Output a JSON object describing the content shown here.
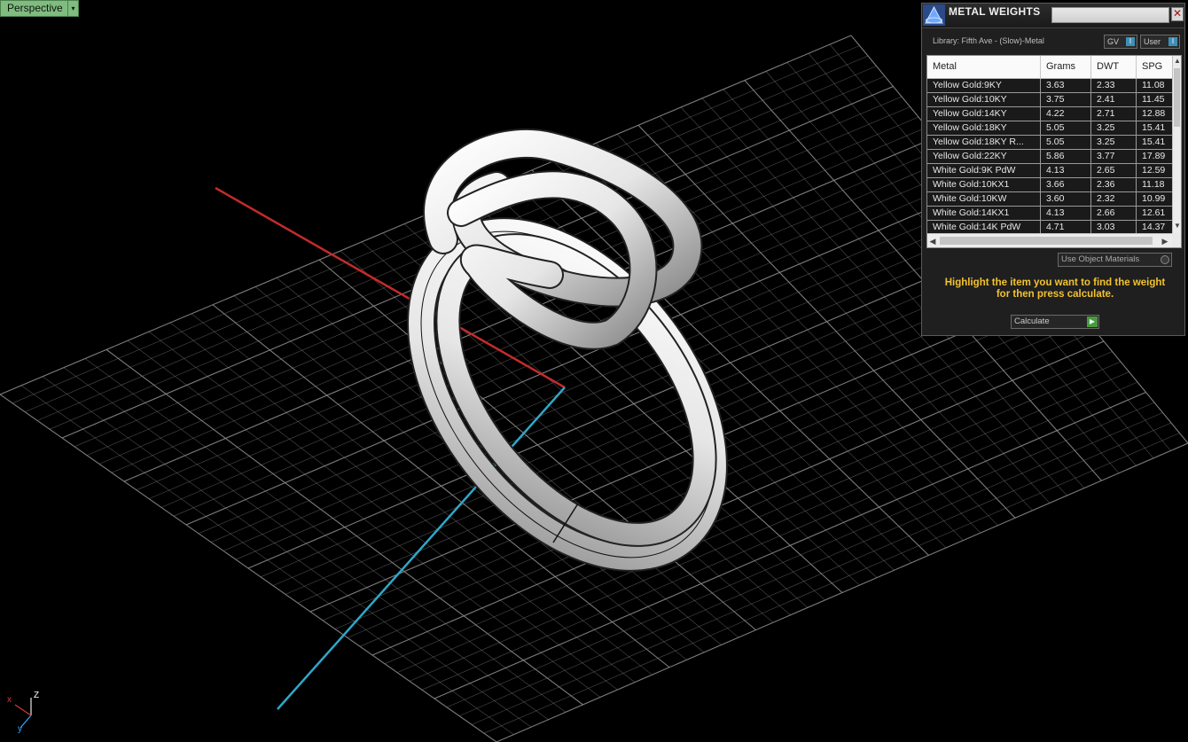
{
  "viewport": {
    "label": "Perspective",
    "menu_glyph": "▾",
    "axis_labels": {
      "z": "Z",
      "y": "y",
      "x": "x"
    }
  },
  "panel": {
    "title": "METAL WEIGHTS",
    "close_glyph": "✕",
    "library": "Library: Fifth Ave - (Slow)-Metal",
    "toggles": [
      {
        "label": "GV",
        "glyph": "I"
      },
      {
        "label": "User",
        "glyph": "I"
      }
    ],
    "columns": [
      "Metal",
      "Grams",
      "DWT",
      "SPG"
    ],
    "rows": [
      [
        "Yellow Gold:9KY",
        "3.63",
        "2.33",
        "11.08"
      ],
      [
        "Yellow Gold:10KY",
        "3.75",
        "2.41",
        "11.45"
      ],
      [
        "Yellow Gold:14KY",
        "4.22",
        "2.71",
        "12.88"
      ],
      [
        "Yellow Gold:18KY",
        "5.05",
        "3.25",
        "15.41"
      ],
      [
        "Yellow Gold:18KY R...",
        "5.05",
        "3.25",
        "15.41"
      ],
      [
        "Yellow Gold:22KY",
        "5.86",
        "3.77",
        "17.89"
      ],
      [
        "White Gold:9K PdW",
        "4.13",
        "2.65",
        "12.59"
      ],
      [
        "White Gold:10KX1",
        "3.66",
        "2.36",
        "11.18"
      ],
      [
        "White Gold:10KW",
        "3.60",
        "2.32",
        "10.99"
      ],
      [
        "White Gold:14KX1",
        "4.13",
        "2.66",
        "12.61"
      ],
      [
        "White Gold:14K PdW",
        "4.71",
        "3.03",
        "14.37"
      ]
    ],
    "use_object_materials": "Use Object Materials",
    "hint_line1": "Highlight the item you want to find the weight",
    "hint_line2": "for then press calculate.",
    "calculate_label": "Calculate",
    "calculate_glyph": "▶"
  },
  "colors": {
    "background": "#000000",
    "grid": "#8a8a8a",
    "x_axis": "#c42b2b",
    "y_axis": "#2fa7c8",
    "viewport_label_bg": "#7fbd7f",
    "hint_text": "#f2c230"
  }
}
